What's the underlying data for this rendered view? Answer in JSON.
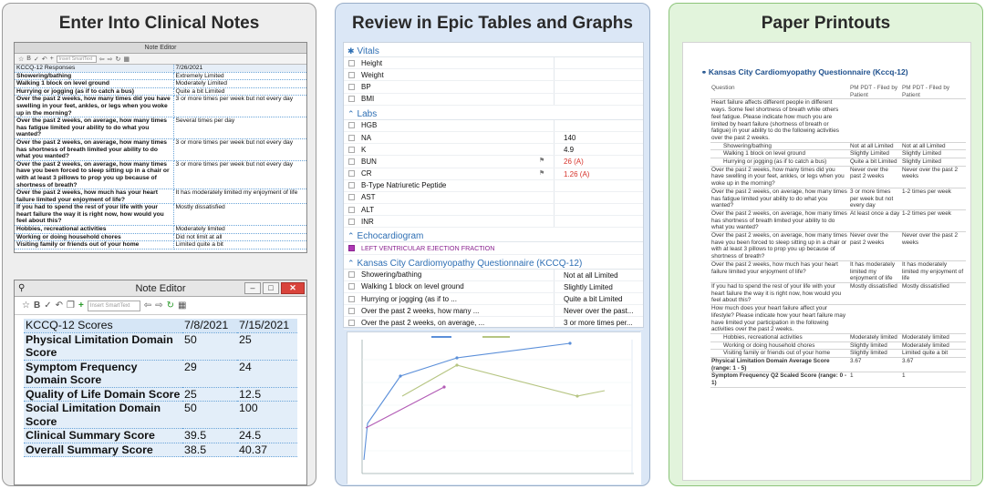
{
  "panels": {
    "clinical_notes": {
      "title": "Enter Into Clinical Notes",
      "editor1": {
        "title": "Note Editor",
        "smarttext_placeholder": "Insert SmartText",
        "header": [
          "KCCQ-12 Responses",
          "7/26/2021"
        ],
        "rows": [
          [
            "Showering/bathing",
            "Extremely Limited"
          ],
          [
            "Walking 1 block on level ground",
            "Moderately Limited"
          ],
          [
            "Hurrying or jogging (as if to catch a bus)",
            "Quite a bit Limited"
          ],
          [
            "Over the past 2 weeks, how many times did you have swelling in your feet, ankles, or legs when you woke up in the morning?",
            "3 or more times per week but not every day"
          ],
          [
            "Over the past 2 weeks, on average, how many times has fatigue limited your ability to do what you wanted?",
            "Several times per day"
          ],
          [
            "Over the past 2 weeks, on average, how many times has shortness of breath limited your ability to do what you wanted?",
            "3 or more times per week but not every day"
          ],
          [
            "Over the past 2 weeks, on average, how many times have you been forced to sleep sitting up in a chair or with at least 3 pillows to prop you up because of shortness of breath?",
            "3 or more times per week but not every day"
          ],
          [
            "Over the past 2 weeks, how much has your heart failure limited your enjoyment of life?",
            "It has moderately limited my enjoyment of life"
          ],
          [
            "If you had to spend the rest of your life with your heart failure the way it is right now, how would you feel about this?",
            "Mostly dissatisfied"
          ],
          [
            "Hobbies, recreational activities",
            "Moderately limited"
          ],
          [
            "Working or doing household chores",
            "Did not limit at all"
          ],
          [
            "Visiting family or friends out of your home",
            "Limited quite a bit"
          ]
        ]
      },
      "editor2": {
        "title": "Note Editor",
        "smarttext_placeholder": "Insert SmartText",
        "header": [
          "KCCQ-12 Scores",
          "7/8/2021",
          "7/15/2021"
        ],
        "rows": [
          [
            "Physical Limitation Domain Score",
            "50",
            "25"
          ],
          [
            "Symptom Frequency Domain Score",
            "29",
            "24"
          ],
          [
            "Quality of Life Domain Score",
            "25",
            "12.5"
          ],
          [
            "Social Limitation Domain Score",
            "50",
            "100"
          ],
          [
            "Clinical Summary Score",
            "39.5",
            "24.5"
          ],
          [
            "Overall Summary Score",
            "38.5",
            "40.37"
          ]
        ]
      }
    },
    "epic": {
      "title": "Review in Epic Tables and Graphs",
      "vitals_label": "Vitals",
      "vitals": [
        {
          "label": "Height",
          "value": ""
        },
        {
          "label": "Weight",
          "value": ""
        },
        {
          "label": "BP",
          "value": ""
        },
        {
          "label": "BMI",
          "value": ""
        }
      ],
      "labs_label": "Labs",
      "labs": [
        {
          "label": "HGB",
          "value": "",
          "critical": false
        },
        {
          "label": "NA",
          "value": "140",
          "critical": false
        },
        {
          "label": "K",
          "value": "4.9",
          "critical": false
        },
        {
          "label": "BUN",
          "value": "26 (A)",
          "critical": true
        },
        {
          "label": "CR",
          "value": "1.26 (A)",
          "critical": true
        },
        {
          "label": "B-Type Natriuretic Peptide",
          "value": "",
          "critical": false
        },
        {
          "label": "AST",
          "value": "",
          "critical": false
        },
        {
          "label": "ALT",
          "value": "",
          "critical": false
        },
        {
          "label": "INR",
          "value": "",
          "critical": false
        }
      ],
      "echo_label": "Echocardiogram",
      "echo_item": "LEFT VENTRICULAR EJECTION FRACTION",
      "kccq_label": "Kansas City Cardiomyopathy Questionnaire (KCCQ-12)",
      "kccq": [
        {
          "label": "Showering/bathing",
          "value": "Not at all Limited"
        },
        {
          "label": "Walking 1 block on level ground",
          "value": "Slightly Limited"
        },
        {
          "label": "Hurrying or jogging (as if to ...",
          "value": "Quite a bit Limited"
        },
        {
          "label": "Over the past 2 weeks, how many ...",
          "value": "Never over the past..."
        },
        {
          "label": "Over the past 2 weeks, on average, ...",
          "value": "3 or more times per..."
        }
      ]
    },
    "paper": {
      "title": "Paper Printouts",
      "heading": "Kansas City Cardiomyopathy Questionnaire (Kccq-12)",
      "header": [
        "Question",
        "PM PDT - Filed by Patient",
        "PM PDT - Filed by Patient"
      ],
      "rows": [
        {
          "q": "Heart failure affects different people in different ways. Some feel shortness of breath while others feel fatigue. Please indicate how much you are limited by heart failure (shortness of breath or fatigue) in your ability to do the following activities over the past 2 weeks.",
          "a": "",
          "b": "",
          "indent": false,
          "bold": false
        },
        {
          "q": "Showering/bathing",
          "a": "Not at all Limited",
          "b": "Not at all Limited",
          "indent": true,
          "bold": false
        },
        {
          "q": "Walking 1 block on level ground",
          "a": "Slightly Limited",
          "b": "Slightly Limited",
          "indent": true,
          "bold": false
        },
        {
          "q": "Hurrying or jogging (as if to catch a bus)",
          "a": "Quite a bit Limited",
          "b": "Slightly Limited",
          "indent": true,
          "bold": false
        },
        {
          "q": "Over the past 2 weeks, how many times did you have swelling in your feet, ankles, or legs when you woke up in the morning?",
          "a": "Never over the past 2 weeks",
          "b": "Never over the past 2 weeks",
          "indent": false,
          "bold": false
        },
        {
          "q": "Over the past 2 weeks, on average, how many times has fatigue limited your ability to do what you wanted?",
          "a": "3 or more times per week but not every day",
          "b": "1-2 times per week",
          "indent": false,
          "bold": false
        },
        {
          "q": "Over the past 2 weeks, on average, how many times has shortness of breath limited your ability to do what you wanted?",
          "a": "At least once a day",
          "b": "1-2 times per week",
          "indent": false,
          "bold": false
        },
        {
          "q": "Over the past 2 weeks, on average, how many times have you been forced to sleep sitting up in a chair or with at least 3 pillows to prop you up because of shortness of breath?",
          "a": "Never over the past 2 weeks",
          "b": "Never over the past 2 weeks",
          "indent": false,
          "bold": false
        },
        {
          "q": "Over the past 2 weeks, how much has your heart failure limited your enjoyment of life?",
          "a": "It has moderately limited my enjoyment of life",
          "b": "It has moderately limited my enjoyment of life",
          "indent": false,
          "bold": false
        },
        {
          "q": "If you had to spend the rest of your life with your heart failure the way it is right now, how would you feel about this?",
          "a": "Mostly dissatisfied",
          "b": "Mostly dissatisfied",
          "indent": false,
          "bold": false
        },
        {
          "q": "How much does your heart failure affect your lifestyle? Please indicate how your heart failure may have limited your participation in the following activities over the past 2 weeks.",
          "a": "",
          "b": "",
          "indent": false,
          "bold": false
        },
        {
          "q": "Hobbies, recreational activities",
          "a": "Moderately limited",
          "b": "Moderately limited",
          "indent": true,
          "bold": false
        },
        {
          "q": "Working or doing household chores",
          "a": "Slightly limited",
          "b": "Moderately limited",
          "indent": true,
          "bold": false
        },
        {
          "q": "Visiting family or friends out of your home",
          "a": "Slightly limited",
          "b": "Limited quite a bit",
          "indent": true,
          "bold": false
        },
        {
          "q": "Physical Limitation Domain Average Score (range: 1 - 5)",
          "a": "3.67",
          "b": "3.67",
          "indent": false,
          "bold": true
        },
        {
          "q": "Symptom Frequency Q2 Scaled Score (range: 0 - 1)",
          "a": "1",
          "b": "1",
          "indent": false,
          "bold": true
        }
      ]
    }
  },
  "colors": {
    "epic_link_blue": "#2e6fb4",
    "critical_red": "#d6322a",
    "echo_purple": "#8a2390",
    "line_blue": "#5b8fd9",
    "line_olive": "#b6c582",
    "line_magenta": "#b25bb5",
    "panel_grey": "#eeeeee",
    "panel_blue": "#dbe7f6",
    "panel_green": "#e2f4dc"
  }
}
